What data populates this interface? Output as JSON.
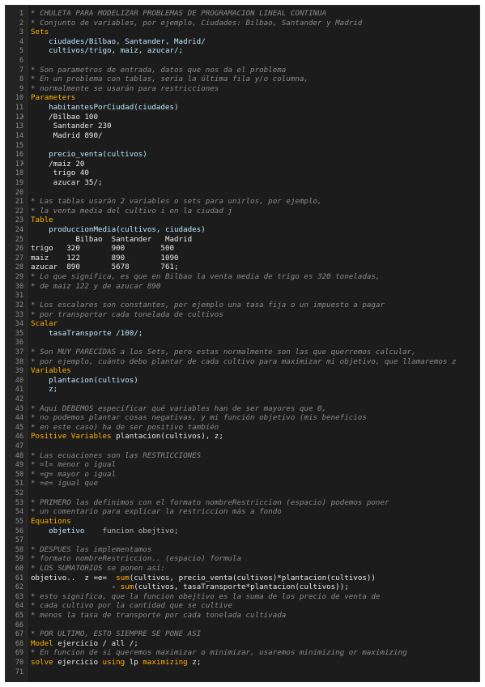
{
  "editor": {
    "lines": [
      {
        "n": "1",
        "segs": [
          {
            "t": "* CHULETA PARA MODELIZAR PROBLEMAS DE PROGRAMACION LINEAL CONTINUA",
            "c": "comment"
          }
        ]
      },
      {
        "n": "2",
        "segs": [
          {
            "t": "* Conjunto de variables, por ejemplo, Ciudades: Bilbao, Santander y Madrid",
            "c": "comment"
          }
        ]
      },
      {
        "n": "3",
        "segs": [
          {
            "t": "Sets",
            "c": "kw"
          }
        ]
      },
      {
        "n": "4",
        "segs": [
          {
            "t": "    ciudades/Bilbao, Santander, Madrid/",
            "c": "ident"
          }
        ]
      },
      {
        "n": "5",
        "segs": [
          {
            "t": "    cultivos/trigo, maiz, azucar/;",
            "c": "ident"
          }
        ]
      },
      {
        "n": "6",
        "segs": []
      },
      {
        "n": "7",
        "segs": [
          {
            "t": "* Son parametros de entrada, datos que nos da el problema",
            "c": "comment"
          }
        ]
      },
      {
        "n": "8",
        "segs": [
          {
            "t": "* En un problema con tablas, sería la última fila y/o columna,",
            "c": "comment"
          }
        ]
      },
      {
        "n": "9",
        "segs": [
          {
            "t": "* normalmente se usarán para restricciones",
            "c": "comment"
          }
        ]
      },
      {
        "n": "10",
        "segs": [
          {
            "t": "Parameters",
            "c": "kw"
          }
        ]
      },
      {
        "n": "11",
        "segs": [
          {
            "t": "    habitantesPorCiudad(ciudades)",
            "c": "ident"
          }
        ]
      },
      {
        "n": "12",
        "fold": true,
        "segs": [
          {
            "t": "    /Bilbao 100",
            "c": "plain"
          }
        ]
      },
      {
        "n": "13",
        "segs": [
          {
            "t": "     Santander 230",
            "c": "plain"
          }
        ]
      },
      {
        "n": "14",
        "segs": [
          {
            "t": "     Madrid 890/",
            "c": "plain"
          }
        ]
      },
      {
        "n": "15",
        "segs": []
      },
      {
        "n": "16",
        "segs": [
          {
            "t": "    precio_venta(cultivos)",
            "c": "ident"
          }
        ]
      },
      {
        "n": "17",
        "fold": true,
        "segs": [
          {
            "t": "    /maiz 20",
            "c": "plain"
          }
        ]
      },
      {
        "n": "18",
        "segs": [
          {
            "t": "     trigo 40",
            "c": "plain"
          }
        ]
      },
      {
        "n": "19",
        "segs": [
          {
            "t": "     azucar 35/;",
            "c": "plain"
          }
        ]
      },
      {
        "n": "20",
        "segs": []
      },
      {
        "n": "21",
        "segs": [
          {
            "t": "* Las tablas usarán 2 variables o sets para unirlos, por ejemplo,",
            "c": "comment"
          }
        ]
      },
      {
        "n": "22",
        "segs": [
          {
            "t": "* la venta media del cultivo i en la ciudad j",
            "c": "comment"
          }
        ]
      },
      {
        "n": "23",
        "segs": [
          {
            "t": "Table",
            "c": "kw"
          }
        ]
      },
      {
        "n": "24",
        "segs": [
          {
            "t": "    produccionMedia(cultivos, ciudades)",
            "c": "ident"
          }
        ]
      },
      {
        "n": "25",
        "segs": [
          {
            "t": "          Bilbao  Santander   Madrid",
            "c": "plain"
          }
        ]
      },
      {
        "n": "26",
        "segs": [
          {
            "t": "trigo   320       900        500",
            "c": "plain"
          }
        ]
      },
      {
        "n": "27",
        "segs": [
          {
            "t": "maiz    122       890        1090",
            "c": "plain"
          }
        ]
      },
      {
        "n": "28",
        "segs": [
          {
            "t": "azucar  890       5678       761;",
            "c": "plain"
          }
        ]
      },
      {
        "n": "29",
        "segs": [
          {
            "t": "* Lo que significa, es que en Bilbao la venta media de trigo es 320 toneladas,",
            "c": "comment"
          }
        ]
      },
      {
        "n": "30",
        "segs": [
          {
            "t": "* de maiz 122 y de azucar 890",
            "c": "comment"
          }
        ]
      },
      {
        "n": "31",
        "segs": []
      },
      {
        "n": "32",
        "segs": [
          {
            "t": "* Los escalares son constantes, por ejemplo una tasa fija o un impuesto a pagar",
            "c": "comment"
          }
        ]
      },
      {
        "n": "33",
        "segs": [
          {
            "t": "* por transportar cada tonelada de cultivos",
            "c": "comment"
          }
        ]
      },
      {
        "n": "34",
        "segs": [
          {
            "t": "Scalar",
            "c": "kw"
          }
        ]
      },
      {
        "n": "35",
        "segs": [
          {
            "t": "    tasaTransporte /100/;",
            "c": "ident"
          }
        ]
      },
      {
        "n": "36",
        "segs": []
      },
      {
        "n": "37",
        "segs": [
          {
            "t": "* Son MUY PARECIDAS a los Sets, pero estas normalmente son las que querremos calcular,",
            "c": "comment"
          }
        ]
      },
      {
        "n": "38",
        "segs": [
          {
            "t": "* por ejemplo, cuánto debo plantar de cada cultivo para maximizar mi objetivo, que llamaremos z",
            "c": "comment"
          }
        ]
      },
      {
        "n": "39",
        "segs": [
          {
            "t": "Variables",
            "c": "kw"
          }
        ]
      },
      {
        "n": "40",
        "segs": [
          {
            "t": "    plantacion(cultivos)",
            "c": "ident"
          }
        ]
      },
      {
        "n": "41",
        "segs": [
          {
            "t": "    z;",
            "c": "ident"
          }
        ]
      },
      {
        "n": "42",
        "segs": []
      },
      {
        "n": "43",
        "segs": [
          {
            "t": "* Aqui DEBEMOS especificar qué variables han de ser mayores que 0,",
            "c": "comment"
          }
        ]
      },
      {
        "n": "44",
        "segs": [
          {
            "t": "* no podemos plantar cosas negativas, y mi función objetivo (mis beneficios",
            "c": "comment"
          }
        ]
      },
      {
        "n": "45",
        "segs": [
          {
            "t": "* en este caso) ha de ser positivo también",
            "c": "comment"
          }
        ]
      },
      {
        "n": "46",
        "segs": [
          {
            "t": "Positive Variables ",
            "c": "kw"
          },
          {
            "t": "plantacion(cultivos), z;",
            "c": "plain"
          }
        ]
      },
      {
        "n": "47",
        "segs": []
      },
      {
        "n": "48",
        "segs": [
          {
            "t": "* Las ecuaciones son las RESTRICCIONES",
            "c": "comment"
          }
        ]
      },
      {
        "n": "49",
        "segs": [
          {
            "t": "* =l= menor o igual",
            "c": "comment"
          }
        ]
      },
      {
        "n": "50",
        "segs": [
          {
            "t": "* =g= mayor o igual",
            "c": "comment"
          }
        ]
      },
      {
        "n": "51",
        "segs": [
          {
            "t": "* =e= igual que",
            "c": "comment"
          }
        ]
      },
      {
        "n": "52",
        "segs": []
      },
      {
        "n": "53",
        "segs": [
          {
            "t": "* PRIMERO las definimos con el formato nombreRestriccion (espacio) podemos poner",
            "c": "comment"
          }
        ]
      },
      {
        "n": "54",
        "segs": [
          {
            "t": "* un comentario para explicar la restriccion más a fondo",
            "c": "comment"
          }
        ]
      },
      {
        "n": "55",
        "segs": [
          {
            "t": "Equations",
            "c": "kw"
          }
        ]
      },
      {
        "n": "56",
        "segs": [
          {
            "t": "    objetivo",
            "c": "ident"
          },
          {
            "t": "    funcion obejtivo;",
            "c": "ph"
          }
        ]
      },
      {
        "n": "57",
        "segs": []
      },
      {
        "n": "58",
        "segs": [
          {
            "t": "* DESPUES las implementamos",
            "c": "comment"
          }
        ]
      },
      {
        "n": "59",
        "segs": [
          {
            "t": "* formato nombreRestriccion.. (espacio) formula",
            "c": "comment"
          }
        ]
      },
      {
        "n": "60",
        "segs": [
          {
            "t": "* LOS SUMATORIOS se ponen así:",
            "c": "comment"
          }
        ]
      },
      {
        "n": "61",
        "segs": [
          {
            "t": "objetivo..  z =e=  ",
            "c": "plain"
          },
          {
            "t": "sum",
            "c": "kw"
          },
          {
            "t": "(cultivos, precio_venta(cultivos)*plantacion(cultivos))",
            "c": "plain"
          }
        ]
      },
      {
        "n": "62",
        "segs": [
          {
            "t": "                  - ",
            "c": "plain"
          },
          {
            "t": "sum",
            "c": "kw"
          },
          {
            "t": "(cultivos, tasaTransporte*plantacion(cultivos));",
            "c": "plain"
          }
        ]
      },
      {
        "n": "63",
        "segs": [
          {
            "t": "* esto significa, que la funcion obejtivo es la suma de los precio de venta de",
            "c": "comment"
          }
        ]
      },
      {
        "n": "64",
        "segs": [
          {
            "t": "* cada cultivo por la cantidad que se cultive",
            "c": "comment"
          }
        ]
      },
      {
        "n": "65",
        "segs": [
          {
            "t": "* menos la tasa de transporte por cada tonelada cultivada",
            "c": "comment"
          }
        ]
      },
      {
        "n": "66",
        "segs": []
      },
      {
        "n": "67",
        "segs": [
          {
            "t": "* POR ULTIMO, ESTO SIEMPRE SE PONE ASI",
            "c": "comment"
          }
        ]
      },
      {
        "n": "68",
        "segs": [
          {
            "t": "Model ",
            "c": "kw"
          },
          {
            "t": "ejercicio / all /;",
            "c": "plain"
          }
        ]
      },
      {
        "n": "69",
        "segs": [
          {
            "t": "* En funcion de si queremos maximizar o minimizar, usaremos minimizing or maximizing",
            "c": "comment"
          }
        ]
      },
      {
        "n": "70",
        "segs": [
          {
            "t": "solve ",
            "c": "kw"
          },
          {
            "t": "ejercicio ",
            "c": "plain"
          },
          {
            "t": "using ",
            "c": "kw"
          },
          {
            "t": "lp ",
            "c": "plain"
          },
          {
            "t": "maximizing ",
            "c": "kw"
          },
          {
            "t": "z;",
            "c": "plain"
          }
        ]
      },
      {
        "n": "71",
        "segs": []
      }
    ]
  }
}
